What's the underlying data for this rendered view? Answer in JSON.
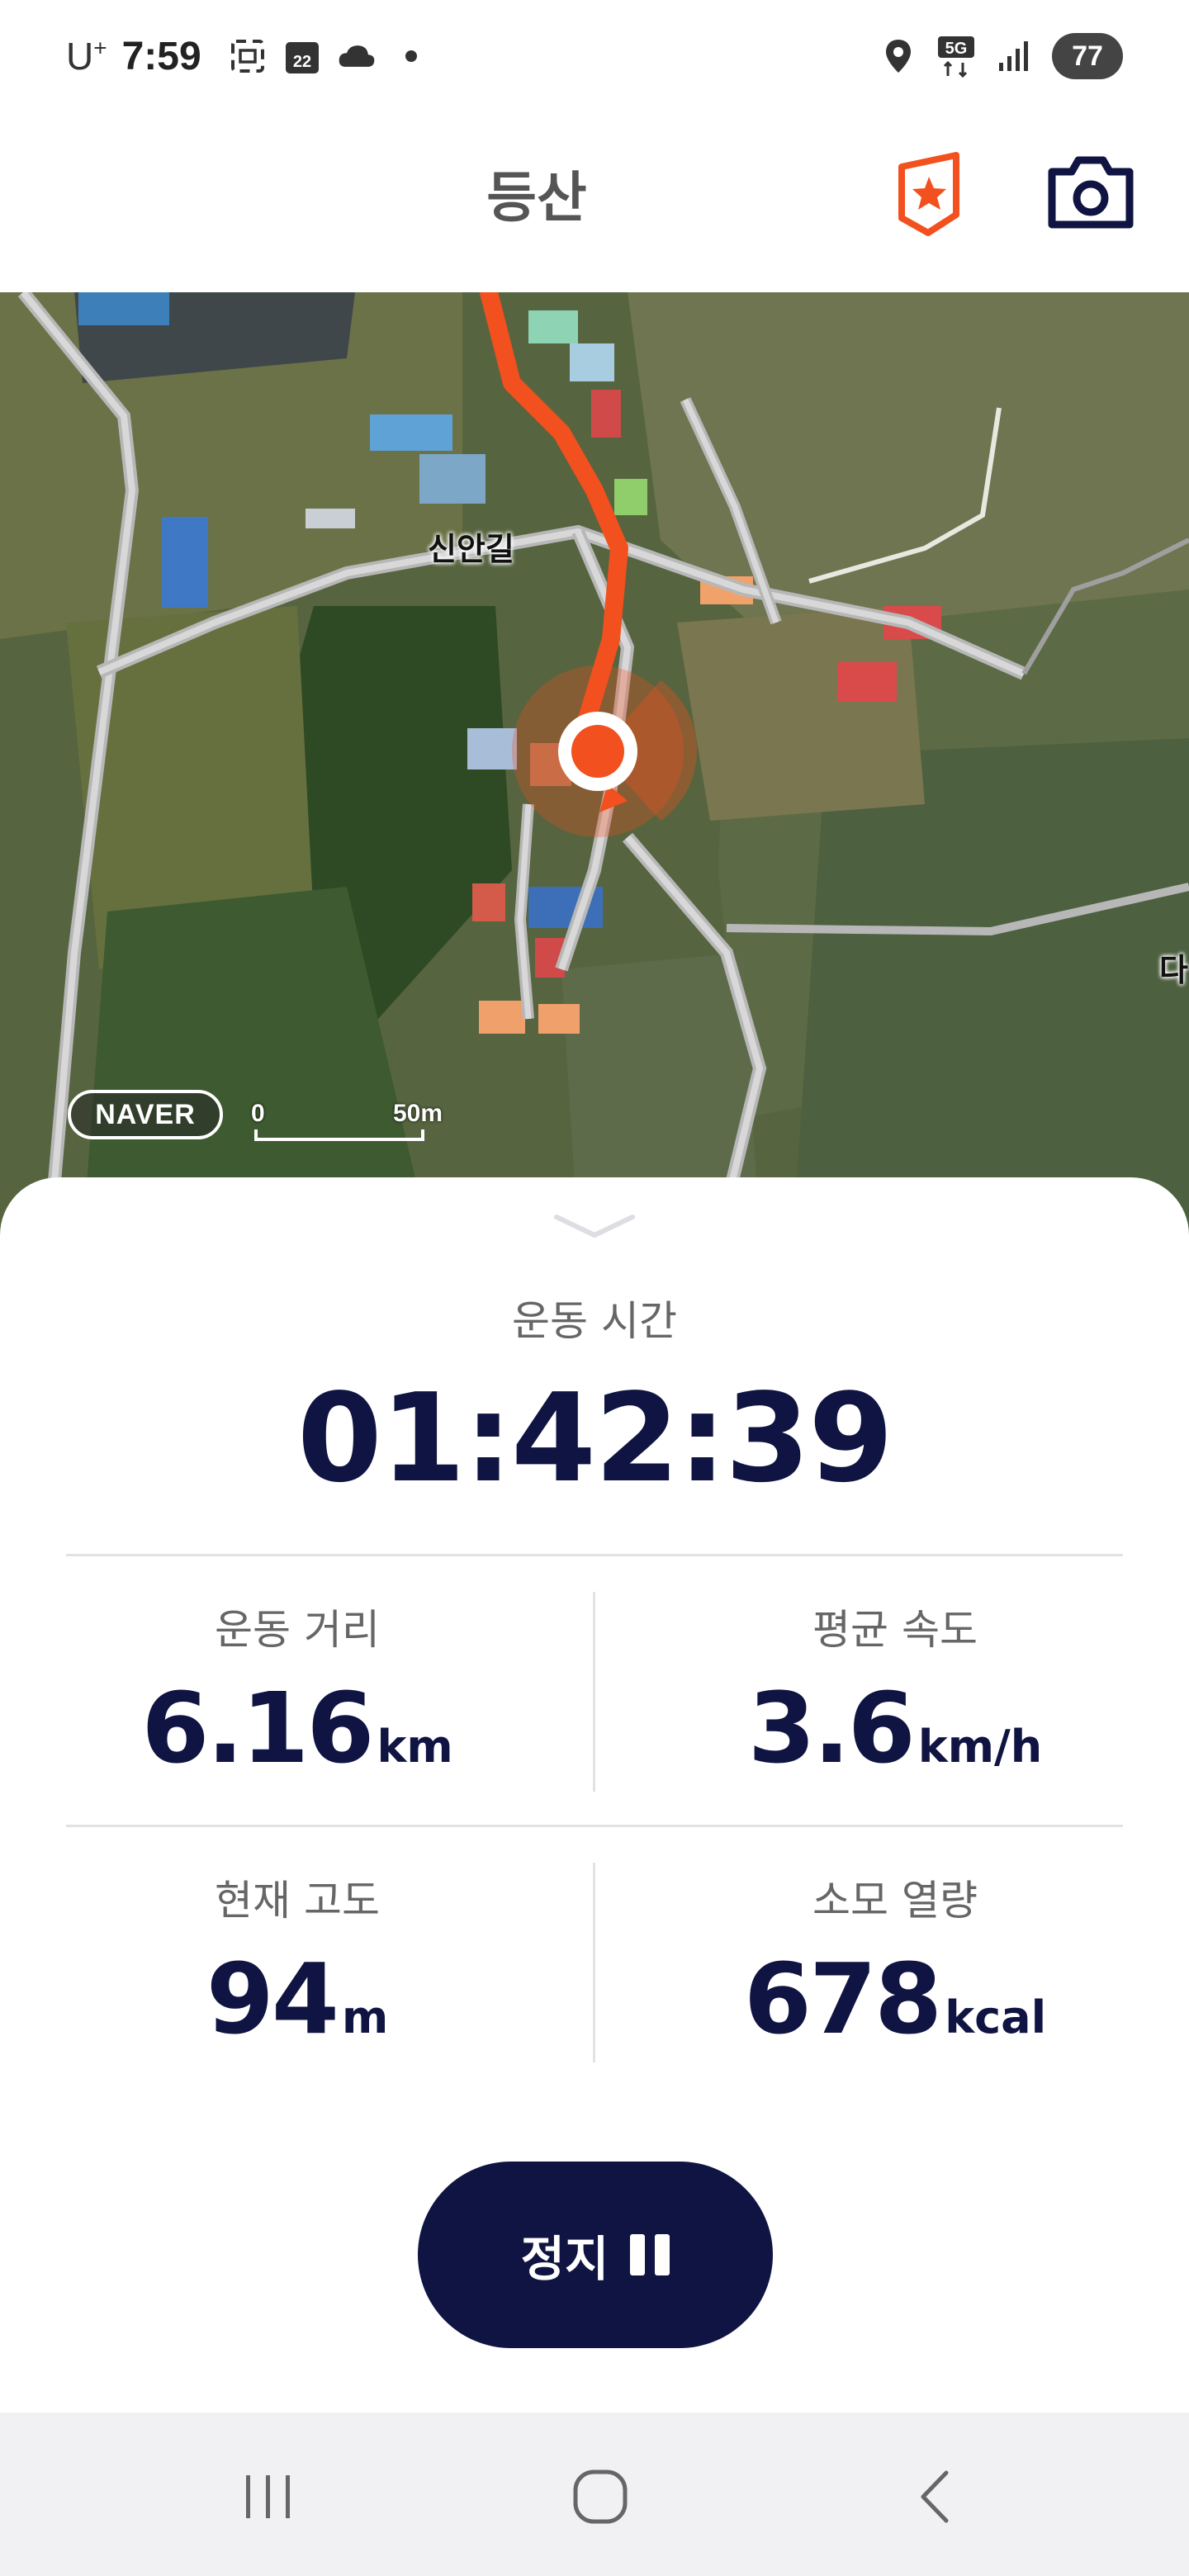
{
  "status_bar": {
    "carrier": "U",
    "carrier_sup": "+",
    "time": "7:59",
    "calendar_day": "22",
    "network": "5G",
    "battery": "77",
    "icons": [
      "screenshot-icon",
      "calendar-icon",
      "cloud-icon",
      "dot-icon",
      "location-icon",
      "5g-icon",
      "signal-icon"
    ]
  },
  "header": {
    "title": "등산",
    "badge_icon": "badge-star-icon",
    "camera_icon": "camera-icon",
    "accent_color": "#f2501e"
  },
  "map": {
    "road_label": "신안길",
    "edge_label": "다",
    "logo": "NAVER",
    "scale_zero": "0",
    "scale_distance": "50m",
    "route_color": "#f2501e"
  },
  "workout": {
    "time_label": "운동 시간",
    "time_value": "01:42:39",
    "stats": [
      {
        "label": "운동 거리",
        "value": "6.16",
        "unit": "km"
      },
      {
        "label": "평균 속도",
        "value": "3.6",
        "unit": "km/h"
      },
      {
        "label": "현재 고도",
        "value": "94",
        "unit": "m"
      },
      {
        "label": "소모 열량",
        "value": "678",
        "unit": "kcal"
      }
    ],
    "stop_button": "정지"
  },
  "nav_bar": {
    "icons": [
      "recent-apps-icon",
      "home-icon",
      "back-icon"
    ]
  },
  "colors": {
    "primary": "#0f1442",
    "accent": "#f2501e"
  }
}
